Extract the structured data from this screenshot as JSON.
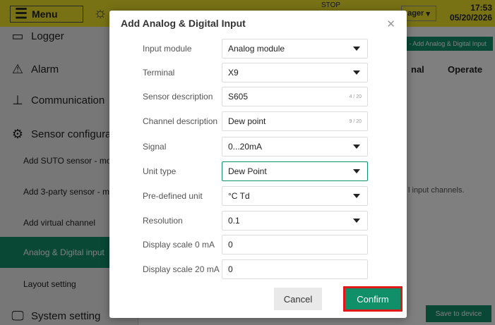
{
  "topbar": {
    "menu_label": "Menu",
    "stop_text": "STOP",
    "user_label": "ager",
    "time": "17:53",
    "date": "05/20/2026"
  },
  "sidebar": {
    "logger": "Logger",
    "alarm": "Alarm",
    "communication": "Communication",
    "sensor_config": "Sensor configura",
    "add_suto": "Add SUTO sensor - mo",
    "add_3party": "Add 3-party sensor - mo",
    "add_virtual": "Add virtual channel",
    "analog_digital": "Analog & Digital input",
    "layout_setting": "Layout setting",
    "system_setting": "System setting"
  },
  "main": {
    "add_tag": "- Add Analog & Digital Input",
    "col_nal": "nal",
    "col_operate": "Operate",
    "info": "l input channels.",
    "save_device": "Save to device"
  },
  "dialog": {
    "title": "Add Analog & Digital Input",
    "fields": {
      "input_module": {
        "label": "Input module",
        "value": "Analog module"
      },
      "terminal": {
        "label": "Terminal",
        "value": "X9"
      },
      "sensor_description": {
        "label": "Sensor description",
        "value": "S605",
        "count": "4 / 20"
      },
      "channel_description": {
        "label": "Channel description",
        "value": "Dew point",
        "count": "9 / 20"
      },
      "signal": {
        "label": "Signal",
        "value": "0...20mA"
      },
      "unit_type": {
        "label": "Unit type",
        "value": "Dew Point"
      },
      "predefined_unit": {
        "label": "Pre-defined unit",
        "value": "°C Td"
      },
      "resolution": {
        "label": "Resolution",
        "value": "0.1"
      },
      "display_scale_0": {
        "label": "Display scale 0 mA",
        "value": "0"
      },
      "display_scale_20": {
        "label": "Display scale 20 mA",
        "value": "0"
      }
    },
    "cancel_label": "Cancel",
    "confirm_label": "Confirm"
  },
  "colors": {
    "accent_green": "#109068",
    "topbar_yellow": "#f1e42a",
    "highlight_red": "#e01818"
  }
}
